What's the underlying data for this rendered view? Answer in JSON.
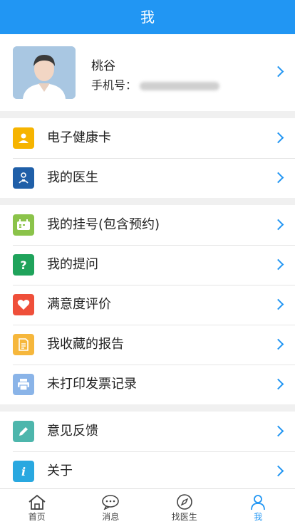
{
  "header": {
    "title": "我"
  },
  "profile": {
    "name": "桃谷",
    "phone_label": "手机号："
  },
  "groups": [
    [
      {
        "label": "电子健康卡",
        "icon": "health-card-icon",
        "color": "#f6b400"
      },
      {
        "label": "我的医生",
        "icon": "doctor-icon",
        "color": "#1f5fa8"
      }
    ],
    [
      {
        "label": "我的挂号(包含预约)",
        "icon": "registration-icon",
        "color": "#8bc34a"
      },
      {
        "label": "我的提问",
        "icon": "question-icon",
        "color": "#1fa35b"
      },
      {
        "label": "满意度评价",
        "icon": "heart-icon",
        "color": "#ef4f3a"
      },
      {
        "label": "我收藏的报告",
        "icon": "report-icon",
        "color": "#f6b73c"
      },
      {
        "label": "未打印发票记录",
        "icon": "printer-icon",
        "color": "#8ab4e8"
      }
    ],
    [
      {
        "label": "意见反馈",
        "icon": "feedback-icon",
        "color": "#4db6ac"
      },
      {
        "label": "关于",
        "icon": "info-icon",
        "color": "#29a8e0"
      }
    ]
  ],
  "tabbar": [
    {
      "label": "首页",
      "icon": "home-icon"
    },
    {
      "label": "消息",
      "icon": "message-icon"
    },
    {
      "label": "找医生",
      "icon": "compass-icon"
    },
    {
      "label": "我",
      "icon": "user-icon",
      "active": true
    }
  ]
}
